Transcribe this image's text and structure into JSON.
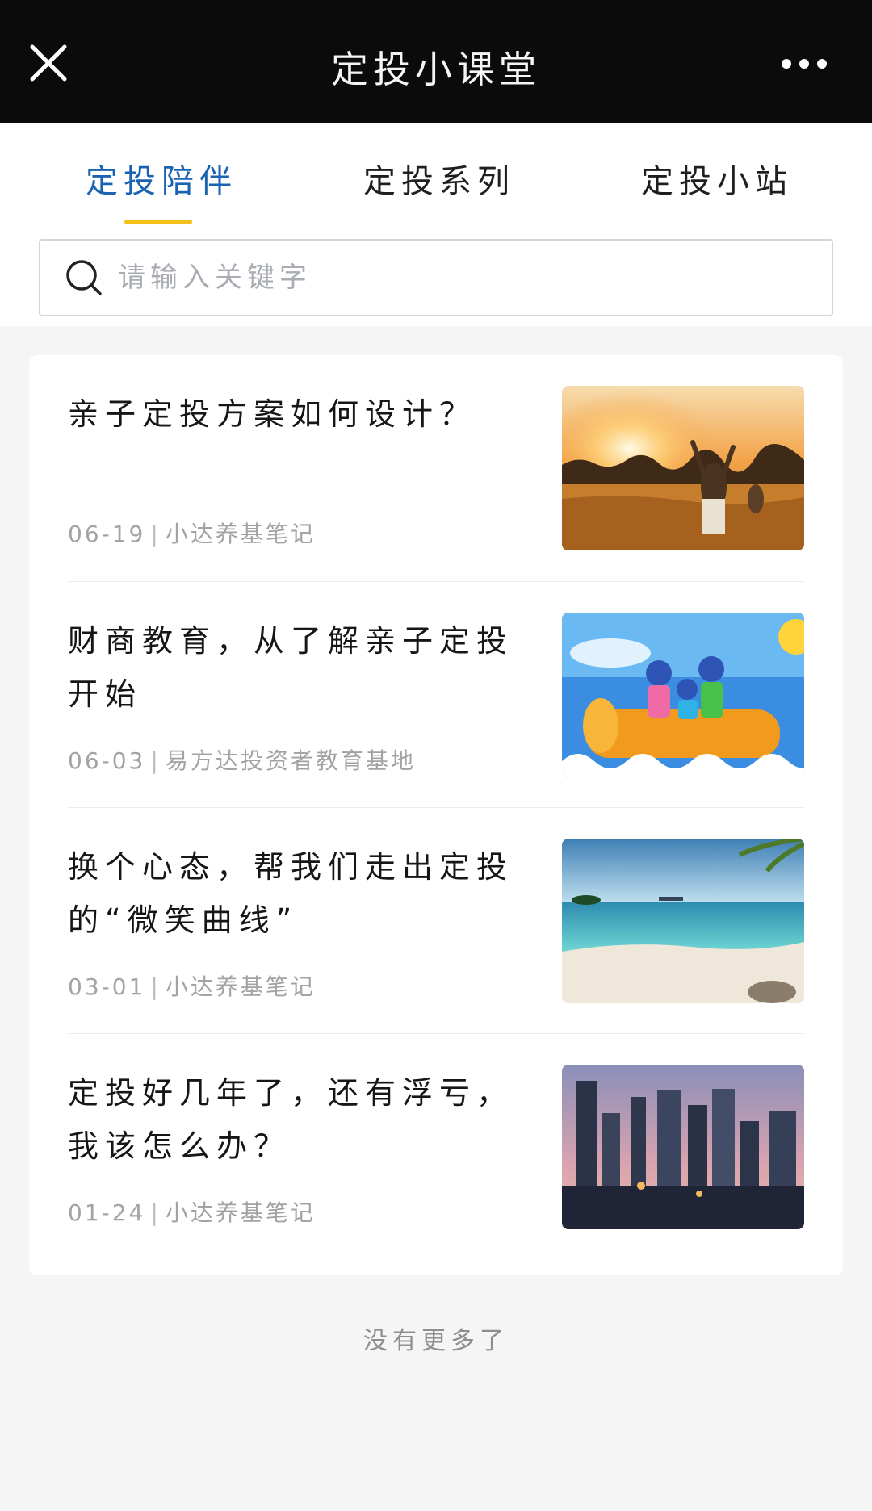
{
  "topbar": {
    "title": "定投小课堂",
    "close_icon": "close-icon",
    "more_icon": "more-icon"
  },
  "tabs": [
    {
      "label": "定投陪伴",
      "active": true
    },
    {
      "label": "定投系列",
      "active": false
    },
    {
      "label": "定投小站",
      "active": false
    }
  ],
  "search": {
    "placeholder": "请输入关键字",
    "value": "",
    "icon": "search-icon"
  },
  "articles": [
    {
      "title": "亲子定投方案如何设计？",
      "date": "06-19",
      "source": "小达养基笔记",
      "thumbnail": "sunset-family-image"
    },
    {
      "title": "财商教育，从了解亲子定投开始",
      "date": "06-03",
      "source": "易方达投资者教育基地",
      "thumbnail": "cartoon-family-boat-image"
    },
    {
      "title": "换个心态，帮我们走出定投的“微笑曲线”",
      "date": "03-01",
      "source": "小达养基笔记",
      "thumbnail": "beach-image"
    },
    {
      "title": "定投好几年了，还有浮亏，我该怎么办？",
      "date": "01-24",
      "source": "小达养基笔记",
      "thumbnail": "city-skyline-image"
    }
  ],
  "footer": {
    "no_more": "没有更多了"
  },
  "colors": {
    "accent": "#1a63b3",
    "tab_indicator": "#f5c01a",
    "topbar": "#0b0b0b"
  }
}
